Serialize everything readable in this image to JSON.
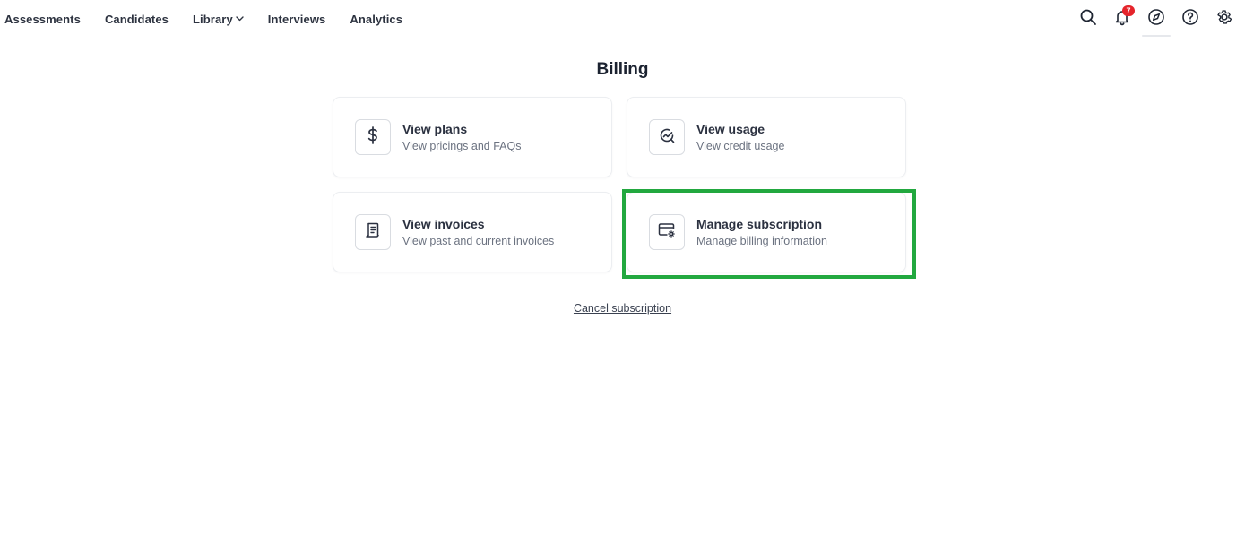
{
  "nav": {
    "items": [
      {
        "label": "Assessments"
      },
      {
        "label": "Candidates"
      },
      {
        "label": "Library"
      },
      {
        "label": "Interviews"
      },
      {
        "label": "Analytics"
      }
    ]
  },
  "header_actions": {
    "notifications_count": "7",
    "icons": [
      "search-icon",
      "bell-icon",
      "compass-icon",
      "help-icon",
      "gear-icon"
    ]
  },
  "page": {
    "title": "Billing"
  },
  "cards": [
    {
      "title": "View plans",
      "subtitle": "View pricings and FAQs",
      "icon": "dollar-icon"
    },
    {
      "title": "View usage",
      "subtitle": "View credit usage",
      "icon": "usage-chart-icon"
    },
    {
      "title": "View invoices",
      "subtitle": "View past and current invoices",
      "icon": "receipt-icon"
    },
    {
      "title": "Manage subscription",
      "subtitle": "Manage billing information",
      "icon": "card-settings-icon"
    }
  ],
  "cancel_link": "Cancel subscription",
  "colors": {
    "highlight": "#22a83f",
    "badge": "#e5242b",
    "text_primary": "#2b3140",
    "text_secondary": "#6b7280"
  }
}
